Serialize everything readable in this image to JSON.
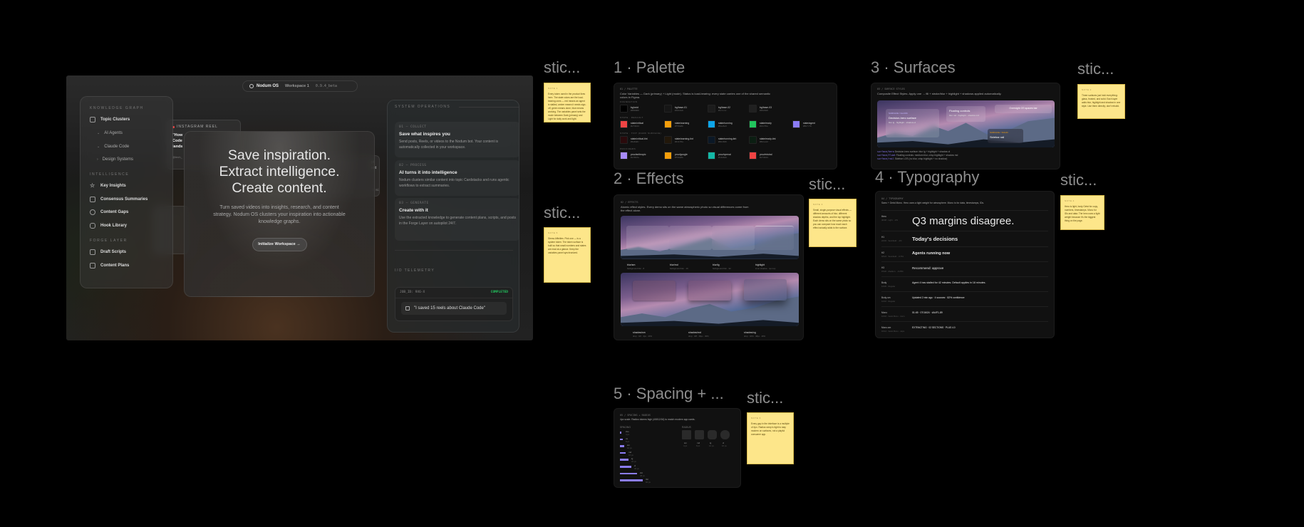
{
  "frames": {
    "palette": "1 · Palette",
    "effects": "2 · Effects",
    "surfaces": "3 · Surfaces",
    "typography": "4 · Typography",
    "spacing": "5 · Spacing + ...",
    "sticky": "stic..."
  },
  "app": {
    "pill": {
      "brand": "Nodum OS",
      "workspace": "Workspace 1",
      "version": "0.9.4_beta"
    },
    "sidebar": {
      "sections": [
        {
          "label": "KNOWLEDGE GRAPH",
          "items": [
            {
              "label": "Topic Clusters",
              "icon": "folder-icon"
            }
          ],
          "sub": [
            "AI Agents",
            "Claude Code",
            "Design Systems"
          ]
        },
        {
          "label": "INTELLIGENCE",
          "items": [
            {
              "label": "Key Insights",
              "icon": "star-icon"
            },
            {
              "label": "Consensus Summaries",
              "icon": "document-icon"
            },
            {
              "label": "Content Gaps",
              "icon": "circle-icon"
            },
            {
              "label": "Hook Library",
              "icon": "hook-icon"
            }
          ]
        },
        {
          "label": "FORGE LAYER",
          "items": [
            {
              "label": "Draft Scripts",
              "icon": "edit-icon"
            },
            {
              "label": "Content Plans",
              "icon": "layout-icon"
            }
          ]
        }
      ]
    },
    "reel": {
      "tag": "INSTAGRAM REEL",
      "text": "\"How Code lands",
      "handle": "@tech_"
    },
    "behind": {
      "line1": "pt",
      "line2": "ext",
      "meta": "4 mi"
    },
    "hero": {
      "line1": "Save inspiration.",
      "line2": "Extract intelligence.",
      "line3": "Create content.",
      "sub": "Turn saved videos into insights, research, and content strategy. Nodum OS clusters your inspiration into actionable knowledge graphs.",
      "cta": "Initialize Workspace →"
    },
    "ops": {
      "title": "SYSTEM OPERATIONS",
      "steps": [
        {
          "step": "01 — COLLECT",
          "title": "Save what inspires you",
          "desc": "Send posts, Reels, or videos to the Nodum bot. Your content is automatically collected in your workspace."
        },
        {
          "step": "02 — PROCESS",
          "title": "AI turns it into intelligence",
          "desc": "Nodum clusters similar content into topic Cardstacks and runs agentic workflows to extract summaries."
        },
        {
          "step": "03 — GENERATE",
          "title": "Create with it",
          "desc": "Use the extracted knowledge to generate content plans, scripts, and posts in the Forge Layer on autopilot 24/7."
        }
      ]
    },
    "telemetry": {
      "title": "I/O TELEMETRY",
      "job": "JOB_ID: 9X6-X",
      "status": "COMPLETED",
      "message": "\"I saved 15 reels about Claude Code\"",
      "status_color": "#22c55e"
    }
  },
  "palette": {
    "eyebrow": "01 / PALETTE",
    "desc": "Color Variables — Dark (primary) + Light (mode). Status is load-bearing: every state carries one of the shared semantic colors in Figma.",
    "groups": [
      {
        "label": "FOUNDATION",
        "swatches": [
          {
            "name": "bg/void",
            "hex": "#000000"
          },
          {
            "name": "bg/base-01",
            "hex": "#161616"
          },
          {
            "name": "bg/base-02",
            "hex": "#1c1c1c"
          },
          {
            "name": "bg/base-03",
            "hex": "#202020"
          }
        ]
      },
      {
        "label": "STATE · DEFAULT",
        "swatches": [
          {
            "name": "state/critical",
            "hex": "#ef4444"
          },
          {
            "name": "state/warning",
            "hex": "#f59e0b"
          },
          {
            "name": "state/running",
            "hex": "#0ea5e9"
          },
          {
            "name": "state/ready",
            "hex": "#22c55e"
          },
          {
            "name": "state/agent",
            "hex": "#8b7cf6"
          }
        ]
      },
      {
        "label": "STATE · TINT (DARK SURFACE)",
        "swatches": [
          {
            "name": "state/critical-tint",
            "hex": "#2a0a0c"
          },
          {
            "name": "state/warning-tint",
            "hex": "#21170a"
          },
          {
            "name": "state/running-tint",
            "hex": "#0b1826"
          },
          {
            "name": "state/ready-tint",
            "hex": "#0b1e12"
          }
        ]
      },
      {
        "label": "PROVIDERS",
        "swatches": [
          {
            "name": "prov/anthropic",
            "hex": "#a78bfa"
          },
          {
            "name": "prov/google",
            "hex": "#f59e0b"
          },
          {
            "name": "prov/openai",
            "hex": "#14b8a6"
          },
          {
            "name": "prov/mistral",
            "hex": "#ef4444"
          }
        ]
      }
    ]
  },
  "surfaces": {
    "eyebrow": "03 / SURFACE STYLES",
    "desc": "Composite Effect Styles. Apply one → fill + stroke/blur + highlight + shadows applied automatically.",
    "cards": [
      {
        "tag": "SURFACE / GLASS",
        "title": "Decision-hero surface",
        "meta": "blur lg · highlight · shadow-xl"
      },
      {
        "tag": "",
        "title": "Floating controls",
        "meta": "blur md · highlight · shadow md"
      },
      {
        "tag": "",
        "title": "Overnight OS spaces bar",
        "meta": ""
      },
      {
        "tag": "SURFACE / SOLID",
        "title": "Sidebar rail",
        "meta": ""
      }
    ],
    "legend": [
      {
        "key": "surface/hero",
        "val": "Decision-hero surface: blur lg + highlight + shadow-xl"
      },
      {
        "key": "surface/float",
        "val": "Floating controls: medium blur, crisp highlight + shadow md"
      },
      {
        "key": "surface/rail",
        "val": "Sidebar LOS (no blur, crisp highlight + no shadow)"
      }
    ]
  },
  "effects": {
    "eyebrow": "02 / EFFECTS",
    "desc": "Atomic effect styles. Every demo sits on the same atmospheric photo so visual differences come from the effect alone.",
    "row1": [
      {
        "name": "blur/sm",
        "meta": "background blur · 8"
      },
      {
        "name": "blur/md",
        "meta": "background blur · 16"
      },
      {
        "name": "blur/lg",
        "meta": "background blur · 32"
      },
      {
        "name": "highlight",
        "meta": "inner shadow · 1px top"
      }
    ],
    "row2": [
      {
        "name": "shadow/sm",
        "meta": "drop · 0/2 · 4px · 20%"
      },
      {
        "name": "shadow/md",
        "meta": "drop · 0/8 · 16px · 30%"
      },
      {
        "name": "shadow/xg",
        "meta": "drop · 0/24 · 48px · 40%"
      }
    ]
  },
  "typography": {
    "eyebrow": "04 / TYPOGRAPHY",
    "desc": "Sans + Geist Mono. Hero uses a light weight for atmosphere. Mono is for data, timestamps, IDs.",
    "rows": [
      {
        "token": "Hero",
        "spec": "40/48 · Light · -2%",
        "sample": "Q3 margins disagree.",
        "size": 15,
        "weight": "300"
      },
      {
        "token": "H1",
        "spec": "24/32 · Semibold · -1%",
        "sample": "Today's decisions",
        "size": 7.5,
        "weight": "bold"
      },
      {
        "token": "H2",
        "spec": "18/24 · Semibold · -0.5%",
        "sample": "Agents running now",
        "size": 5.5,
        "weight": "bold"
      },
      {
        "token": "H3",
        "spec": "15/20 · Medium · -0.25%",
        "sample": "Recommend: approve",
        "size": 4.5,
        "weight": "normal"
      },
      {
        "token": "Body",
        "spec": "14/20 · Regular",
        "sample": "Agent 4 has stalled for 42 minutes. Default applies in 18 minutes.",
        "size": 3.6,
        "weight": "normal"
      },
      {
        "token": "Body-sm",
        "spec": "12/16 · Regular",
        "sample": "Updated 2 min ago · 4 sources · 82% confidence",
        "size": 3.4,
        "weight": "normal"
      },
      {
        "token": "Mono",
        "spec": "12/16 · Geist Mono · tnum",
        "sample": "01:45 · 07/16/24 · #A4F1-89",
        "size": 3.4,
        "weight": "normal"
      },
      {
        "token": "Mono-sm",
        "spec": "10/14 · Geist Mono · caps",
        "sample": "EXTRACTING · 02 SECTIONS · PLUS 4.0",
        "size": 3.2,
        "weight": "normal"
      }
    ]
  },
  "spacing": {
    "eyebrow": "05 / SPACING + RADIUS",
    "desc": "4px scale. Radius tokens high (4/8/12/16) to match modern app cards.",
    "spacing_label": "SPACING",
    "radius_label": "RADIUS",
    "space": [
      {
        "t": "2xs",
        "v": "4 px",
        "w": 2
      },
      {
        "t": "xs",
        "v": "8 px",
        "w": 4
      },
      {
        "t": "sm",
        "v": "12 px",
        "w": 6
      },
      {
        "t": "md",
        "v": "16 px",
        "w": 8
      },
      {
        "t": "lg",
        "v": "24 px",
        "w": 12
      },
      {
        "t": "xl",
        "v": "32 px",
        "w": 16
      },
      {
        "t": "2xl",
        "v": "48 px",
        "w": 24
      },
      {
        "t": "3xl",
        "v": "64 px",
        "w": 32
      }
    ],
    "radius": [
      {
        "t": "sm",
        "v": "4 px",
        "r": 1
      },
      {
        "t": "md",
        "v": "8 px",
        "r": 2
      },
      {
        "t": "lg",
        "v": "12 px",
        "r": 4
      },
      {
        "t": "xl",
        "v": "16 px",
        "r": 6
      }
    ]
  },
  "stickies": [
    {
      "label": "NOTE 1",
      "text": "Every token used in the product lives here. The state colors are the load-bearing ones — red means an agent is stalled, amber means it needs sign-off, green means done, blue means working. The variables panel sets the mode between Dark (primary) and Light for daily work and light."
    },
    {
      "label": "NOTE 2",
      "text": "Three surfaces just hold everything: glass, frosted, and solid. Each layer adds blur, highlight and shadow in one style. Use them directly; don't rebuild."
    },
    {
      "label": "NOTE 3",
      "text": "Small, single-purpose visual effects — different amounts of blur, different shadow depths, and the top highlight. Each demo sits on the same photo so you can compare how much each effect actually adds to the surface."
    },
    {
      "label": "NOTE 4",
      "text": "Hero is light, body Geist for copy, numbers, timestamps. Mono for IDs and data. The hero uses a light weight because it's the biggest thing on the page."
    },
    {
      "label": "NOTE 5",
      "text": "Stress Affinities. Pick one — is a system token. The token surface is built so that small numbers and states are read at a glance. Keep the variables panel synchronized."
    },
    {
      "label": "NOTE 6",
      "text": "Every gap in the interface is a multiple of 4px. Radius ramp is tight to stay modern on surfaces, not a playful consumer app."
    }
  ],
  "colors": {
    "accent": "#8b7cf6",
    "sticky": "#fde68a",
    "canvas": "#000000"
  }
}
